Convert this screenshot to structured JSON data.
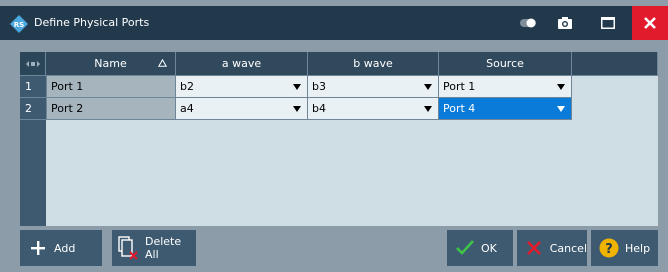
{
  "window": {
    "title": "Define Physical Ports"
  },
  "table": {
    "headers": {
      "name": "Name",
      "a_wave": "a wave",
      "b_wave": "b wave",
      "source": "Source"
    },
    "rows": [
      {
        "num": "1",
        "name": "Port 1",
        "a_wave": "b2",
        "b_wave": "b3",
        "source": "Port 1"
      },
      {
        "num": "2",
        "name": "Port 2",
        "a_wave": "a4",
        "b_wave": "b4",
        "source": "Port 4"
      }
    ]
  },
  "buttons": {
    "add": "Add",
    "delete_all": "Delete All",
    "ok": "OK",
    "cancel": "Cancel",
    "help": "Help"
  },
  "colors": {
    "titlebar": "#22394b",
    "close": "#e21b2c",
    "selection": "#0a7bd8",
    "ok_check": "#3fc24a",
    "cancel_x": "#e21b2c",
    "help_circle": "#f0b400"
  },
  "icons": [
    "rs-logo-icon",
    "toggle-icon",
    "camera-icon",
    "maximize-icon",
    "close-icon",
    "sort-asc-icon",
    "plus-icon",
    "delete-all-icon",
    "check-icon",
    "x-icon",
    "help-icon"
  ]
}
